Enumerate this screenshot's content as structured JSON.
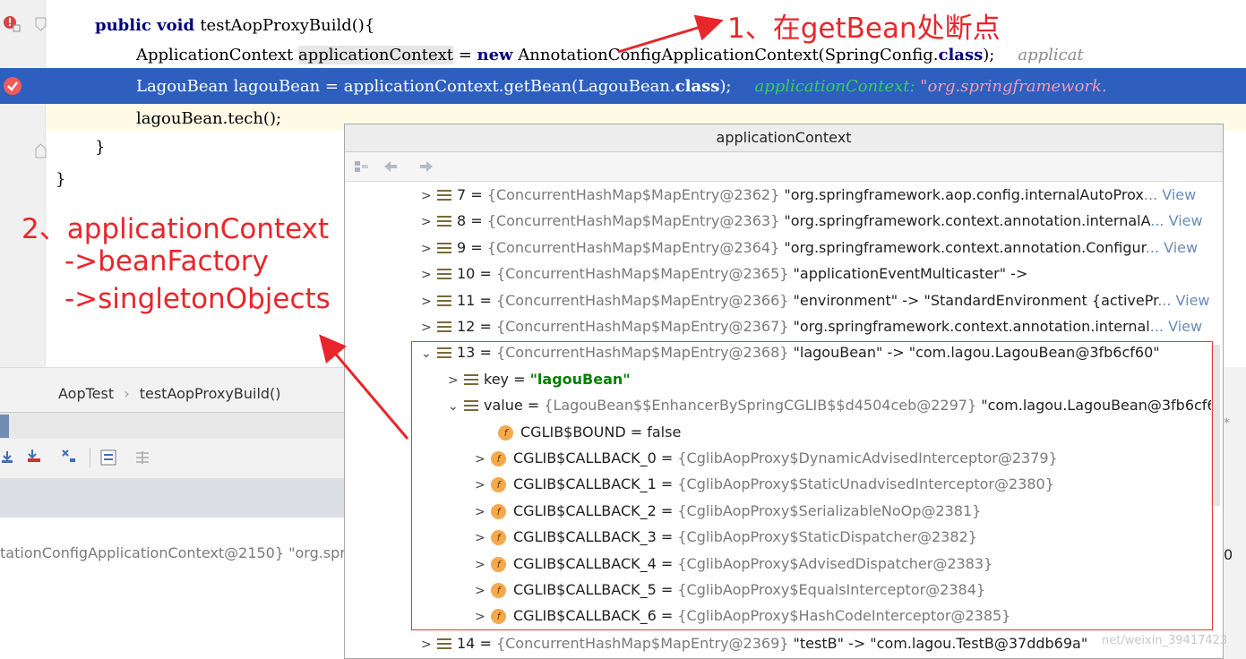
{
  "editor": {
    "lines": [
      {
        "kw": "public void ",
        "text": "testAopProxyBuild(){"
      },
      {
        "t1": "ApplicationContext ",
        "t2": "applicationContext",
        "t3": " = ",
        "kw": "new",
        "t4": " AnnotationConfigApplicationContext(SpringConfig.",
        "kw2": "class",
        "t5": ");",
        "hint": "applicat"
      },
      {
        "t1": "LagouBean lagouBean = applicationContext.getBean(LagouBean.",
        "kw": "class",
        "t2": ");",
        "hint_label": "applicationContext: ",
        "hint_value": "\"org.springframework."
      },
      {
        "text": "lagouBean.tech();"
      },
      {
        "text": "}"
      },
      {
        "text": "}"
      }
    ]
  },
  "breadcrumb": {
    "class_name": "AopTest",
    "separator": "›",
    "method": "testAopProxyBuild()"
  },
  "frames": {
    "partial_text": "tationConfigApplicationContext@2150} \"org.spr"
  },
  "right_strip_text": "0",
  "popup": {
    "title": "applicationContext",
    "rows": [
      {
        "name": "7",
        "ref": "{ConcurrentHashMap$MapEntry@2362}",
        "val": "\"org.springframework.aop.config.internalAutoProx",
        "link": "... View"
      },
      {
        "name": "8",
        "ref": "{ConcurrentHashMap$MapEntry@2363}",
        "val": "\"org.springframework.context.annotation.internalA",
        "link": "... View"
      },
      {
        "name": "9",
        "ref": "{ConcurrentHashMap$MapEntry@2364}",
        "val": "\"org.springframework.context.annotation.Configur",
        "link": "... View"
      },
      {
        "name": "10",
        "ref": "{ConcurrentHashMap$MapEntry@2365}",
        "val": "\"applicationEventMulticaster\" ->",
        "link": ""
      },
      {
        "name": "11",
        "ref": "{ConcurrentHashMap$MapEntry@2366}",
        "val": "\"environment\" -> \"StandardEnvironment {activePr",
        "link": "... View"
      },
      {
        "name": "12",
        "ref": "{ConcurrentHashMap$MapEntry@2367}",
        "val": "\"org.springframework.context.annotation.internal",
        "link": "... View"
      },
      {
        "name": "13",
        "ref": "{ConcurrentHashMap$MapEntry@2368}",
        "val": "\"lagouBean\" -> \"com.lagou.LagouBean@3fb6cf60\"",
        "link": ""
      }
    ],
    "key_row": {
      "name": "key",
      "val": "\"lagouBean\""
    },
    "value_row": {
      "name": "value",
      "ref": "{LagouBean$$EnhancerBySpringCGLIB$$d4504ceb@2297}",
      "val": "\"com.lagou.LagouBean@3fb6cf6"
    },
    "bound_row": {
      "name": "CGLIB$BOUND",
      "val": "false"
    },
    "callbacks": [
      {
        "name": "CGLIB$CALLBACK_0",
        "val": "{CglibAopProxy$DynamicAdvisedInterceptor@2379}"
      },
      {
        "name": "CGLIB$CALLBACK_1",
        "val": "{CglibAopProxy$StaticUnadvisedInterceptor@2380}"
      },
      {
        "name": "CGLIB$CALLBACK_2",
        "val": "{CglibAopProxy$SerializableNoOp@2381}"
      },
      {
        "name": "CGLIB$CALLBACK_3",
        "val": "{CglibAopProxy$StaticDispatcher@2382}"
      },
      {
        "name": "CGLIB$CALLBACK_4",
        "val": "{CglibAopProxy$AdvisedDispatcher@2383}"
      },
      {
        "name": "CGLIB$CALLBACK_5",
        "val": "{CglibAopProxy$EqualsInterceptor@2384}"
      },
      {
        "name": "CGLIB$CALLBACK_6",
        "val": "{CglibAopProxy$HashCodeInterceptor@2385}"
      }
    ],
    "last_row": {
      "name": "14",
      "ref": "{ConcurrentHashMap$MapEntry@2369}",
      "val": "\"testB\" -> \"com.lagou.TestB@37ddb69a\""
    }
  },
  "annotations": {
    "note1": "1、在getBean处断点",
    "note2_line1": "2、applicationContext",
    "note2_line2": "->beanFactory",
    "note2_line3": "->singletonObjects",
    "watermark": "net/weixin_39417423",
    "color": "#e8262b"
  }
}
